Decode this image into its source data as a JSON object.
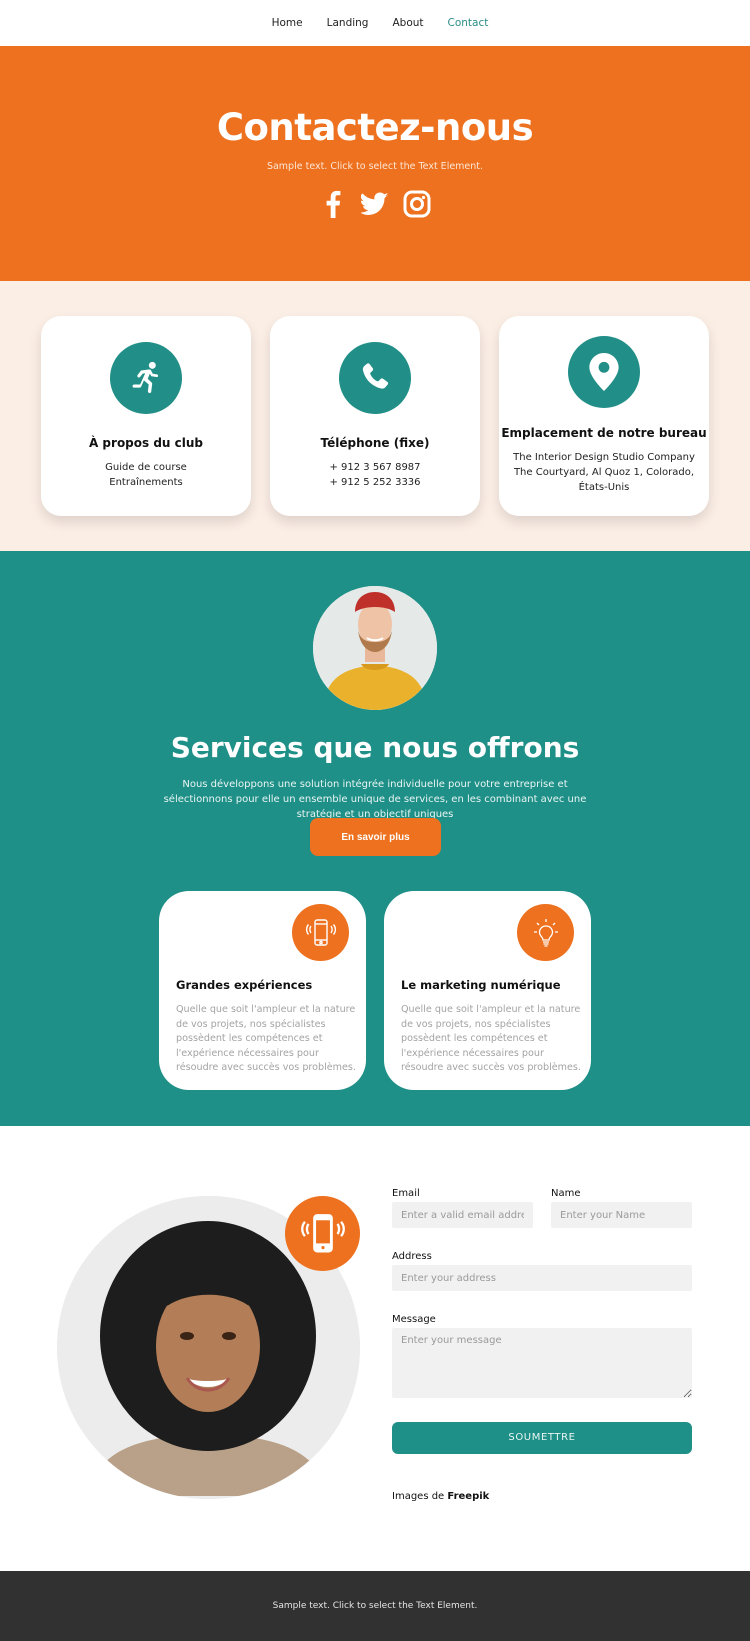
{
  "nav": {
    "items": [
      {
        "label": "Home",
        "active": false
      },
      {
        "label": "Landing",
        "active": false
      },
      {
        "label": "About",
        "active": false
      },
      {
        "label": "Contact",
        "active": true
      }
    ]
  },
  "hero": {
    "title": "Contactez-nous",
    "subtitle": "Sample text. Click to select the Text Element.",
    "socials": [
      "facebook-icon",
      "twitter-icon",
      "instagram-icon"
    ]
  },
  "info_cards": [
    {
      "icon": "running-person-icon",
      "title": "À propos du club",
      "lines": [
        "Guide de course",
        "Entraînements"
      ]
    },
    {
      "icon": "phone-icon",
      "title": "Téléphone (fixe)",
      "lines": [
        "+ 912 3 567 8987",
        "+ 912 5 252 3336"
      ]
    },
    {
      "icon": "map-pin-icon",
      "title": "Emplacement de notre bureau",
      "lines": [
        "The Interior Design Studio Company",
        "The Courtyard, Al Quoz 1, Colorado,",
        "États-Unis"
      ]
    }
  ],
  "services": {
    "title": "Services que nous offrons",
    "description": "Nous développons une solution intégrée individuelle pour votre entreprise et sélectionnons pour elle un ensemble unique de services, en les combinant avec une stratégie et un objectif uniques",
    "button": "En savoir plus",
    "cards": [
      {
        "icon": "smartphone-icon",
        "title": "Grandes expériences",
        "text": "Quelle que soit l'ampleur et la nature de vos projets, nos spécialistes possèdent les compétences et l'expérience nécessaires pour résoudre avec succès vos problèmes."
      },
      {
        "icon": "lightbulb-icon",
        "title": "Le marketing numérique",
        "text": "Quelle que soit l'ampleur et la nature de vos projets, nos spécialistes possèdent les compétences et l'expérience nécessaires pour résoudre avec succès vos problèmes."
      }
    ]
  },
  "form": {
    "email_label": "Email",
    "email_placeholder": "Enter a valid email address",
    "email_value": "",
    "name_label": "Name",
    "name_placeholder": "Enter your Name",
    "name_value": "",
    "address_label": "Address",
    "address_placeholder": "Enter your address",
    "address_value": "",
    "message_label": "Message",
    "message_placeholder": "Enter your message",
    "message_value": "",
    "submit": "SOUMETTRE",
    "credit_prefix": "Images de ",
    "credit_link": "Freepik"
  },
  "footer": {
    "text": "Sample text. Click to select the Text Element."
  },
  "colors": {
    "orange": "#ed711e",
    "teal": "#1f9087",
    "cream": "#fbeee5",
    "footer": "#313131"
  }
}
